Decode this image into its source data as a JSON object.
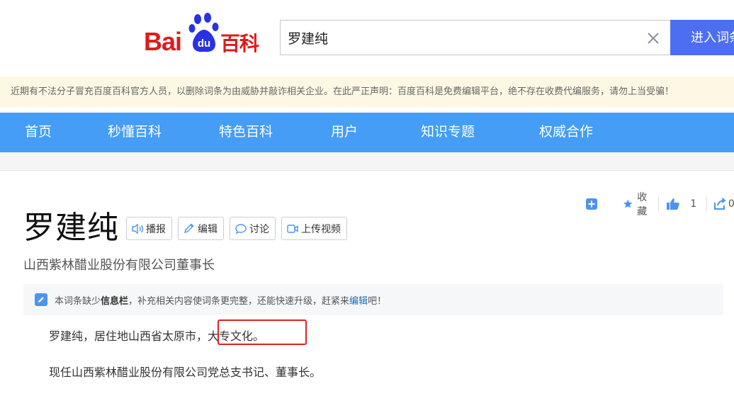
{
  "header": {
    "logo_bai": "Bai",
    "logo_du": "du",
    "logo_baike": "百科",
    "search_value": "罗建纯",
    "search_button": "进入词条",
    "clear_icon": "close-x-icon"
  },
  "notice": "近期有不法分子冒充百度百科官方人员，以删除词条为由威胁并敲诈相关企业。在此严正声明：百度百科是免费编辑平台，绝不存在收费代编服务，请勿上当受骗！",
  "nav": {
    "items": [
      "首页",
      "秒懂百科",
      "特色百科",
      "用户",
      "知识专题",
      "权威合作"
    ]
  },
  "tools": {
    "favorite_label": "收藏",
    "like_count": "1",
    "share_count": "0"
  },
  "entry": {
    "title": "罗建纯",
    "buttons": [
      "播报",
      "编辑",
      "讨论",
      "上传视频"
    ],
    "subtitle": "山西紫林醋业股份有限公司董事长"
  },
  "tip": {
    "prefix": "本词条缺少",
    "bold": "信息栏",
    "middle": "，补充相关内容使词条更完整，还能快速升级，赶紧来",
    "link": "编辑",
    "suffix": "吧！"
  },
  "content": {
    "para1_a": "罗建纯，居住地山西省太原市，",
    "para1_b": "大专文化。",
    "para2": "现任山西紫林醋业股份有限公司党总支书记、董事长。"
  },
  "colors": {
    "brand_red": "#de1b1b",
    "brand_blue": "#2932e1",
    "nav_blue": "#459df5",
    "search_blue": "#4e6ef2",
    "highlight_red": "#e02020"
  }
}
